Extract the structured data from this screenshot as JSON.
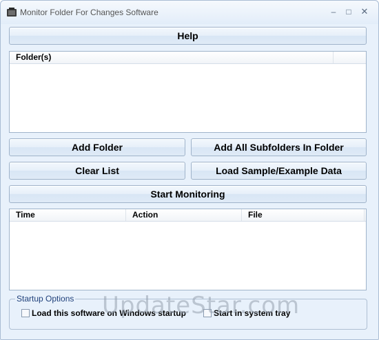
{
  "window": {
    "title": "Monitor Folder For Changes Software",
    "icon": "monitor-folder-app-icon",
    "controls": {
      "minimize": "–",
      "maximize": "□",
      "close": "✕"
    }
  },
  "buttons": {
    "help": "Help",
    "add_folder": "Add Folder",
    "add_all_subfolders": "Add All Subfolders In Folder",
    "clear_list": "Clear List",
    "load_sample": "Load Sample/Example Data",
    "start_monitoring": "Start Monitoring"
  },
  "folders_list": {
    "columns": [
      "Folder(s)"
    ],
    "rows": []
  },
  "events_list": {
    "columns": [
      "Time",
      "Action",
      "File"
    ],
    "rows": []
  },
  "startup_options": {
    "label": "Startup Options",
    "load_on_startup": {
      "label": "Load this software on Windows startup",
      "checked": false
    },
    "start_in_tray": {
      "label": "Start in system tray",
      "checked": false
    }
  },
  "watermark": "UpdateStar.com"
}
